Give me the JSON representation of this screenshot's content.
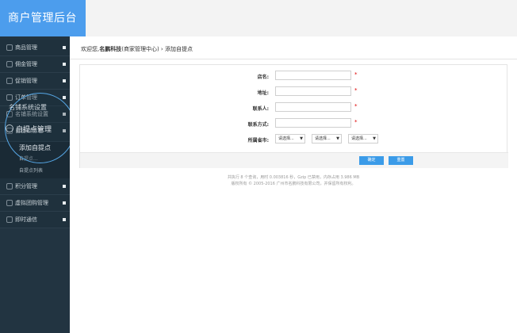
{
  "header": {
    "title": "商户管理后台"
  },
  "sidebar": {
    "items": [
      {
        "label": "商品管理"
      },
      {
        "label": "佣金管理"
      },
      {
        "label": "促销管理"
      },
      {
        "label": "订单管理"
      },
      {
        "label": "名铺系统设置"
      },
      {
        "label": "自提点管理"
      },
      {
        "label": "自提点列表"
      },
      {
        "label": "积分管理"
      },
      {
        "label": "虚拟团购管理"
      },
      {
        "label": "即时通信"
      }
    ],
    "sub_partial": "自提点...",
    "overlay": {
      "system_label": "名铺系统设置",
      "pickup_label": "自提点管理",
      "add_label": "添加自提点"
    }
  },
  "breadcrumb": {
    "prefix": "欢迎您,",
    "brand": "名鹏科技",
    "middle": "(商家管理中心)",
    "sep": " › ",
    "current": "添加自提点"
  },
  "form": {
    "store_name_label": "店名:",
    "address_label": "地址:",
    "contact_label": "联系人:",
    "phone_label": "联系方式:",
    "region_label": "所属省市:",
    "required_mark": "*",
    "select_placeholder": "请选择...",
    "submit_label": "确定",
    "reset_label": "重置"
  },
  "footer": {
    "line1": "共执行 8 个查询，用时 0.003816 秒，Gzip 已禁用，内存占用 3.986 MB",
    "line2": "版权所有 © 2005-2016 广州市名鹏科技有限公司，并保留所有权利。"
  }
}
